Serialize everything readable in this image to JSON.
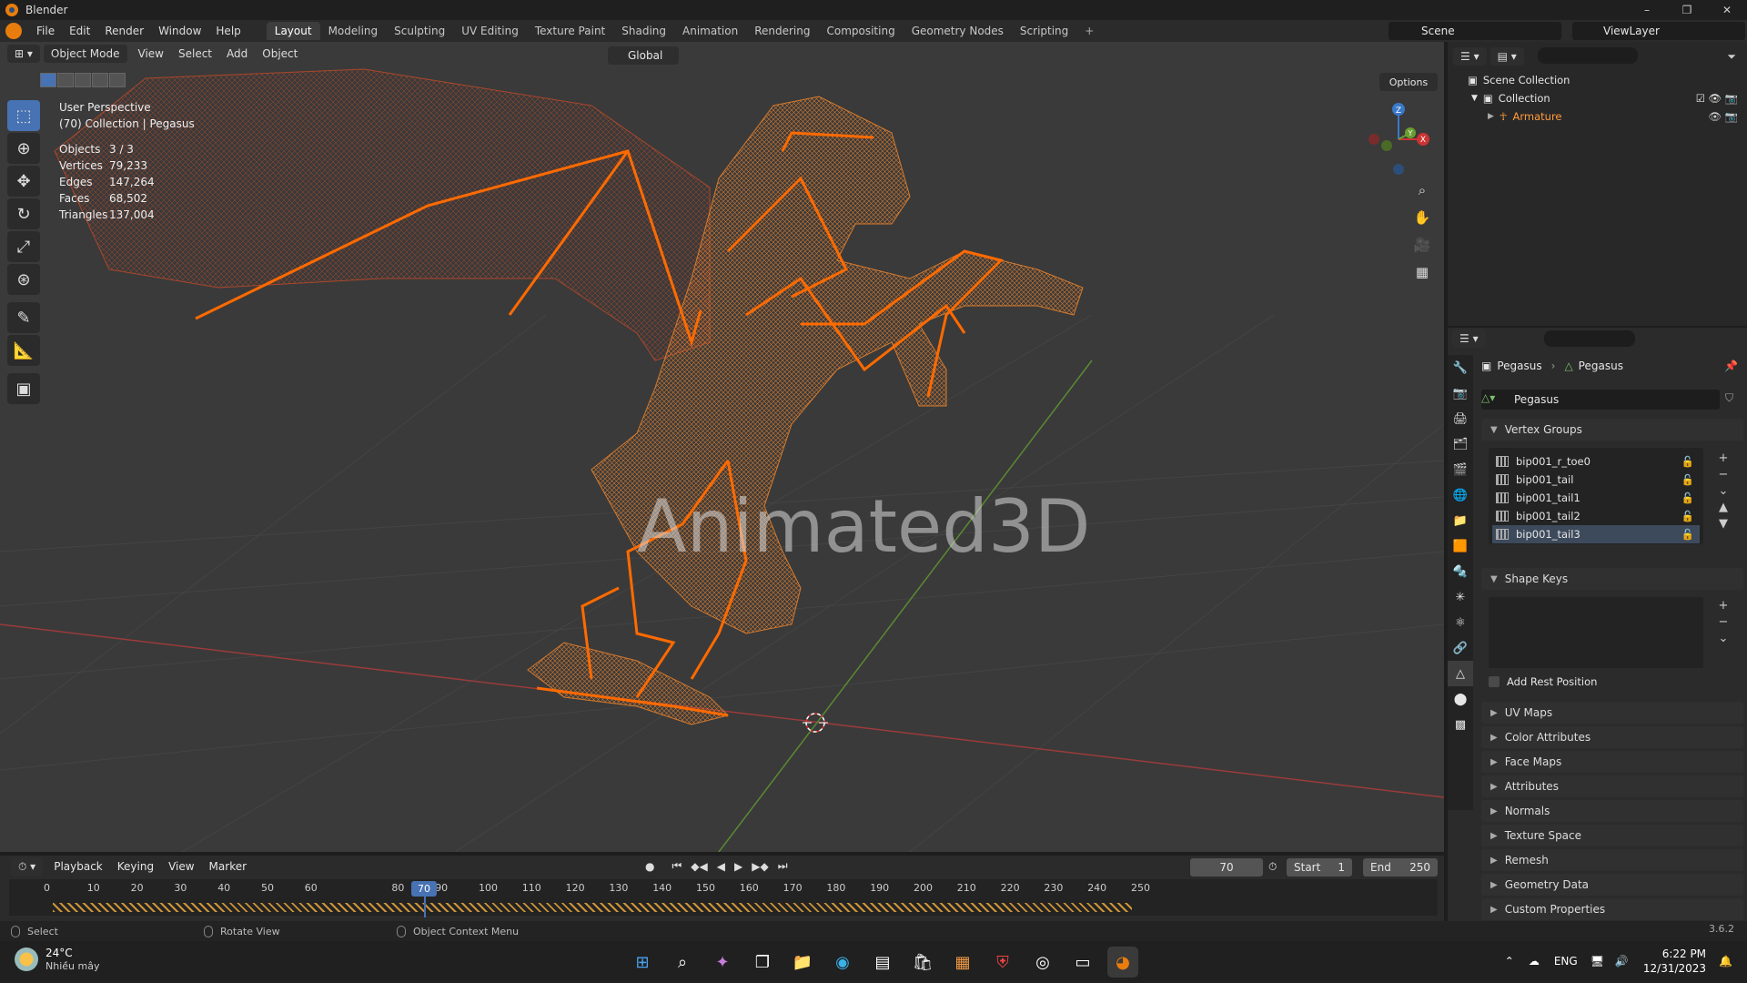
{
  "window": {
    "title": "Blender",
    "minimize": "–",
    "maximize": "❐",
    "close": "✕"
  },
  "menu": [
    "File",
    "Edit",
    "Render",
    "Window",
    "Help"
  ],
  "workspaces": [
    "Layout",
    "Modeling",
    "Sculpting",
    "UV Editing",
    "Texture Paint",
    "Shading",
    "Animation",
    "Rendering",
    "Compositing",
    "Geometry Nodes",
    "Scripting"
  ],
  "workspace_add": "+",
  "scene": {
    "name": "Scene"
  },
  "view_layer": {
    "name": "ViewLayer"
  },
  "viewport": {
    "mode": "Object Mode",
    "menus": [
      "View",
      "Select",
      "Add",
      "Object"
    ],
    "transform_orientation": "Global",
    "options": "Options",
    "perspective": "User Perspective",
    "collection_info": "(70) Collection | Pegasus",
    "stats": [
      {
        "k": "Objects",
        "v": "3 / 3"
      },
      {
        "k": "Vertices",
        "v": "79,233"
      },
      {
        "k": "Edges",
        "v": "147,264"
      },
      {
        "k": "Faces",
        "v": "68,502"
      },
      {
        "k": "Triangles",
        "v": "137,004"
      }
    ],
    "watermark": "Animated3D",
    "gizmo_axes": {
      "x": "X",
      "y": "Y",
      "z": "Z"
    }
  },
  "outliner": {
    "scene_collection": "Scene Collection",
    "collection": "Collection",
    "armature": "Armature"
  },
  "properties": {
    "breadcrumb_object": "Pegasus",
    "breadcrumb_data": "Pegasus",
    "mesh_name": "Pegasus",
    "vertex_groups_title": "Vertex Groups",
    "vertex_groups": [
      "bip001_r_toe0",
      "bip001_tail",
      "bip001_tail1",
      "bip001_tail2",
      "bip001_tail3"
    ],
    "shape_keys_title": "Shape Keys",
    "add_rest_position": "Add Rest Position",
    "panels": [
      "UV Maps",
      "Color Attributes",
      "Face Maps",
      "Attributes",
      "Normals",
      "Texture Space",
      "Remesh",
      "Geometry Data",
      "Custom Properties"
    ]
  },
  "timeline": {
    "menus": [
      "Playback",
      "Keying",
      "View",
      "Marker"
    ],
    "current_frame": "70",
    "start_label": "Start",
    "start": "1",
    "end_label": "End",
    "end": "250",
    "ruler": [
      "0",
      "10",
      "20",
      "30",
      "40",
      "50",
      "60",
      "70",
      "80",
      "90",
      "100",
      "110",
      "120",
      "130",
      "140",
      "150",
      "160",
      "170",
      "180",
      "190",
      "200",
      "210",
      "220",
      "230",
      "240",
      "250"
    ]
  },
  "status": {
    "select": "Select",
    "rotate": "Rotate View",
    "context": "Object Context Menu",
    "version": "3.6.2"
  },
  "taskbar": {
    "weather_temp": "24°C",
    "weather_desc": "Nhiều mây",
    "lang": "ENG",
    "time": "6:22 PM",
    "date": "12/31/2023"
  },
  "colors": {
    "accent": "#4772b3",
    "armature": "#ff6a00",
    "mesh": "#e0802a",
    "blender_orange": "#e87d0d"
  }
}
